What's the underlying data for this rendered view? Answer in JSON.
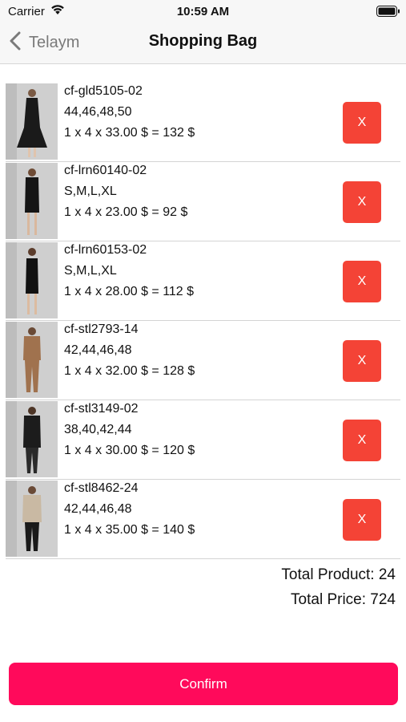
{
  "status_bar": {
    "carrier": "Carrier",
    "time": "10:59 AM"
  },
  "nav": {
    "back_label": "Telaym",
    "title": "Shopping Bag"
  },
  "items": [
    {
      "code": "cf-gld5105-02",
      "sizes": "44,46,48,50",
      "calc": "1 x 4 x 33.00 $ = 132 $",
      "remove_label": "X"
    },
    {
      "code": "cf-lrn60140-02",
      "sizes": "S,M,L,XL",
      "calc": "1 x 4 x 23.00 $ = 92 $",
      "remove_label": "X"
    },
    {
      "code": "cf-lrn60153-02",
      "sizes": "S,M,L,XL",
      "calc": "1 x 4 x 28.00 $ = 112 $",
      "remove_label": "X"
    },
    {
      "code": "cf-stl2793-14",
      "sizes": "42,44,46,48",
      "calc": "1 x 4 x 32.00 $ = 128 $",
      "remove_label": "X"
    },
    {
      "code": "cf-stl3149-02",
      "sizes": "38,40,42,44",
      "calc": "1 x 4 x 30.00 $ = 120 $",
      "remove_label": "X"
    },
    {
      "code": "cf-stl8462-24",
      "sizes": "42,44,46,48",
      "calc": "1 x 4 x 35.00 $ = 140 $",
      "remove_label": "X"
    }
  ],
  "totals": {
    "product": "Total Product: 24",
    "price": "Total Price: 724"
  },
  "confirm_label": "Confirm",
  "colors": {
    "remove": "#f44336",
    "confirm": "#ff0a5b"
  }
}
